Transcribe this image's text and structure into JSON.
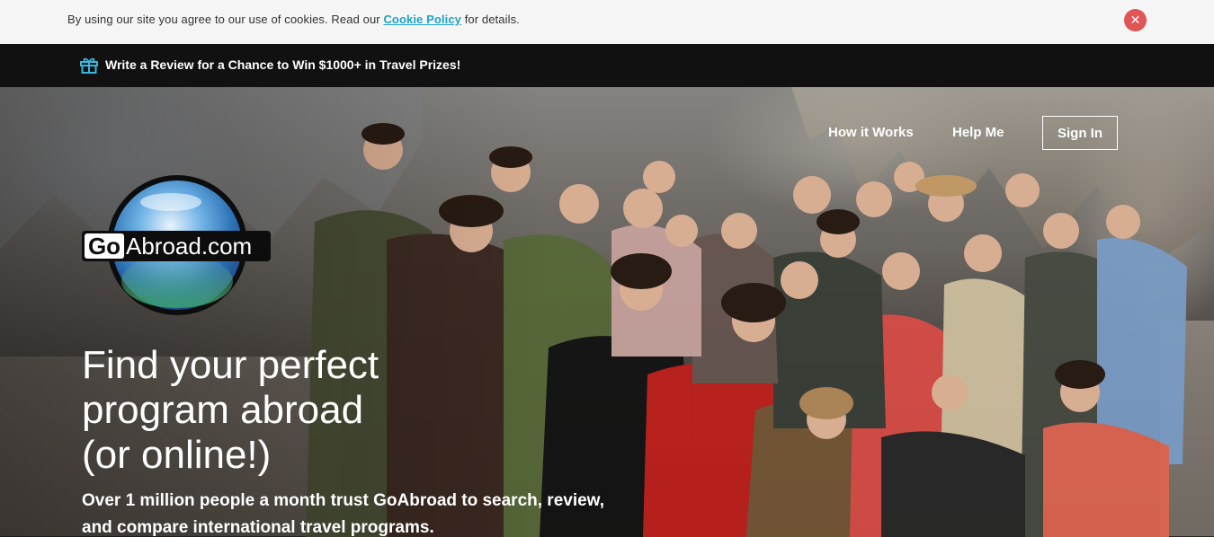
{
  "cookie_bar": {
    "text_before": "By using our site you agree to our use of cookies. Read our",
    "link": "Cookie Policy",
    "text_after": "for details.",
    "close_glyph": "✕",
    "close_color": "#e05555"
  },
  "promo": {
    "icon": "gift-icon",
    "text": "Write a Review for a Chance to Win $1000+ in Travel Prizes!"
  },
  "nav": {
    "how_it_works": "How it Works",
    "help_me": "Help Me",
    "sign_in": "Sign In"
  },
  "logo": {
    "go": "Go",
    "abroad": "Abroad.com"
  },
  "hero": {
    "headline_line1": "Find your perfect",
    "headline_line2": "program abroad",
    "headline_line3": "(or online!)",
    "subline_line1": "Over 1 million people a month trust GoAbroad to search, review,",
    "subline_line2": "and compare international travel programs."
  },
  "colors": {
    "accent": "#1fa3c9",
    "promo_bg": "#111111",
    "cookie_bg": "#f5f5f5"
  }
}
